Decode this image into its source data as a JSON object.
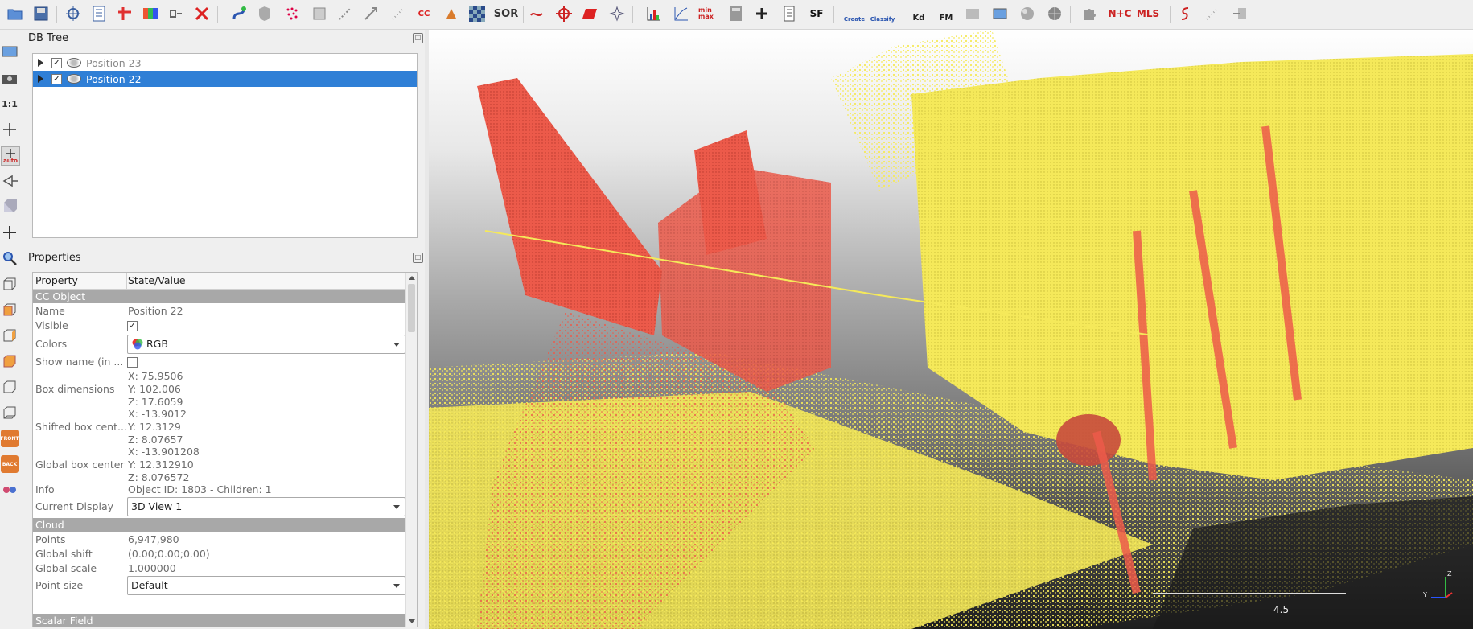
{
  "toolbar_icons": [
    "open-icon",
    "save-icon",
    "transform-icon",
    "properties-icon",
    "pick-point-icon",
    "color-icon",
    "link-icon",
    "delete-icon",
    "segment-icon",
    "shield-icon",
    "sample-icon",
    "subsample-icon",
    "scale-icon",
    "register-icon",
    "noise-icon",
    "cc-icon",
    "cake-icon",
    "checker-icon",
    "sor-icon",
    "cross-section-icon",
    "origin-icon",
    "plane-icon",
    "star-icon",
    "histogram-icon",
    "curve-icon",
    "minmax-icon",
    "calculator-icon",
    "plus-icon",
    "device-icon",
    "sf-icon",
    "canupo-create-icon",
    "canupo-classify-icon",
    "kd-icon",
    "fm-icon",
    "export-icon",
    "image-icon",
    "sphere-icon",
    "globe-icon",
    "puzzle-icon",
    "nc-icon",
    "mls-icon",
    "s-icon",
    "noise2-icon",
    "arrow-icon"
  ],
  "toolbar_text": {
    "cc": "CC",
    "sor": "SOR",
    "sf": "SF",
    "canupo_create": "Create",
    "canupo_classify": "Classify",
    "kd": "Kd",
    "fm": "FM",
    "nc": "N+C",
    "mls": "MLS",
    "minmax": "min max"
  },
  "left_toolbar": {
    "one_to_one": "1:1",
    "auto": "auto",
    "front": "FRONT",
    "back": "BACK"
  },
  "db_tree": {
    "title": "DB Tree",
    "items": [
      {
        "label": "Position 23",
        "checked": "✓",
        "selected": false
      },
      {
        "label": "Position 22",
        "checked": "✓",
        "selected": true
      }
    ]
  },
  "properties": {
    "title": "Properties",
    "header": {
      "property": "Property",
      "value": "State/Value"
    },
    "cc_object": "CC Object",
    "name": {
      "label": "Name",
      "value": "Position 22"
    },
    "visible": {
      "label": "Visible",
      "value": "✓"
    },
    "colors": {
      "label": "Colors",
      "value": "RGB"
    },
    "show_name": {
      "label": "Show name (in ..."
    },
    "box_dimensions": {
      "label": "Box dimensions",
      "x": "X: 75.9506",
      "y": "Y: 102.006",
      "z": "Z: 17.6059"
    },
    "shifted_box_center": {
      "label": "Shifted box cent...",
      "x": "X: -13.9012",
      "y": "Y: 12.3129",
      "z": "Z: 8.07657"
    },
    "global_box_center": {
      "label": "Global box center",
      "x": "X: -13.901208",
      "y": "Y: 12.312910",
      "z": "Z: 8.076572"
    },
    "info": {
      "label": "Info",
      "value": "Object ID: 1803 - Children: 1"
    },
    "current_display": {
      "label": "Current Display",
      "value": "3D View 1"
    },
    "cloud": "Cloud",
    "points": {
      "label": "Points",
      "value": "6,947,980"
    },
    "global_shift": {
      "label": "Global shift",
      "value": "(0.00;0.00;0.00)"
    },
    "global_scale": {
      "label": "Global scale",
      "value": "1.000000"
    },
    "point_size": {
      "label": "Point size",
      "value": "Default"
    },
    "scalar_field": "Scalar Field"
  },
  "viewport": {
    "scale_label": "4.5",
    "axis_y": "Y",
    "axis_z": "Z"
  },
  "colors": {
    "red_cloud": "#ec5a4a",
    "yellow_cloud": "#f5e95a",
    "selection": "#2f7fd6"
  }
}
